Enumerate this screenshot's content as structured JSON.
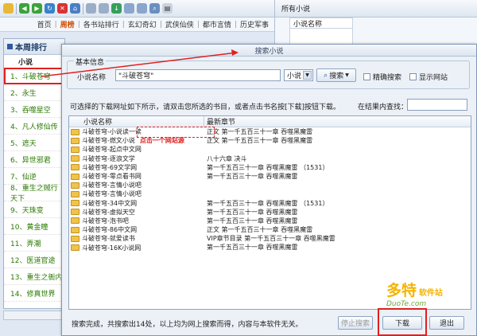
{
  "toolbar": {
    "icons": [
      "folder-icon",
      "back-icon",
      "forward-icon",
      "refresh-icon",
      "stop-icon",
      "home-icon",
      "tab-icon",
      "tab-icon",
      "download-icon",
      "window-icon",
      "window-icon",
      "search-icon",
      "page-icon"
    ]
  },
  "nav": {
    "items": [
      "首页",
      "周榜",
      "各书站排行",
      "玄幻奇幻",
      "武侠仙侠",
      "都市言情",
      "历史军事"
    ],
    "active_index": 1
  },
  "left": {
    "title": "本周排行",
    "column": "小说",
    "items": [
      "1、斗破苍穹",
      "2、永生",
      "3、吞噬星空",
      "4、凡人修仙传",
      "5、遮天",
      "6、异世邪君",
      "7、仙逆",
      "8、重生之贼行天下",
      "9、天珠变",
      "10、黄金瞳",
      "11、弄潮",
      "12、医道官途",
      "13、重生之衙内",
      "14、修真世界"
    ]
  },
  "right": {
    "title": "所有小说",
    "column": "小说名称"
  },
  "dialog": {
    "title": "搜索小说",
    "group_label": "基本信息",
    "name_label": "小说名称",
    "name_value": "\"斗破苍穹\"",
    "select_value": "小说",
    "search_button": "搜索",
    "precise_label": "精确搜索",
    "show_site_label": "显示网站",
    "hint": "可选择的下载网址如下所示，请双击您所选的书目，或者点击书名按[下载]按钮下载。",
    "find_label": "在结果内查找：",
    "col_name": "小说名称",
    "col_chapter": "最新章节",
    "note": "点击一个网站源",
    "rows": [
      {
        "name": "斗破苍穹-小说读一读",
        "chapter": "正文 第一千五百三十一章 吞噬黑魔雷"
      },
      {
        "name": "斗破苍穹-燃文小说",
        "chapter": "正文 第一千五百三十一章 吞噬黑魔雷"
      },
      {
        "name": "斗破苍穹-起点中文网",
        "chapter": ""
      },
      {
        "name": "斗破苍穹-逐浪文学",
        "chapter": "八十六章 决斗"
      },
      {
        "name": "斗破苍穹-69文学网",
        "chapter": "第一千五百三十一章 吞噬黑魔雷 （1531）"
      },
      {
        "name": "斗破苍穹-零点看书网",
        "chapter": "第一千五百三十一章 吞噬黑魔雷"
      },
      {
        "name": "斗破苍穹-言情小说吧",
        "chapter": ""
      },
      {
        "name": "斗破苍穹-言情小说吧",
        "chapter": ""
      },
      {
        "name": "斗破苍穹-34中文网",
        "chapter": "第一千五百三十一章 吞噬黑魔雷 （1531）"
      },
      {
        "name": "斗破苍穹-虚拟天空",
        "chapter": "第一千五百三十一章 吞噬黑魔雷"
      },
      {
        "name": "斗破苍穹-泡书吧",
        "chapter": "第一千五百三十一章 吞噬黑魔雷"
      },
      {
        "name": "斗破苍穹-86中文网",
        "chapter": "正文 第一千五百三十一章 吞噬黑魔雷"
      },
      {
        "name": "斗破苍穹-就爱读书",
        "chapter": "VIP章节目录 第一千五百三十一章 吞噬黑魔雷"
      },
      {
        "name": "斗破苍穹-16K小说网",
        "chapter": "第一千五百三十一章 吞噬黑魔雷"
      }
    ],
    "status": "搜索完成，共搜索出14处，以上均为网上搜索而得，内容与本软件无关。",
    "stop_button": "停止搜索",
    "download_button": "下载",
    "exit_button": "退出"
  },
  "watermark": {
    "big": "多特",
    "sub": "软件站",
    "url": "DuoTe.com"
  },
  "colors": {
    "accent_red": "#e02020",
    "link_green": "#2a7a00"
  }
}
